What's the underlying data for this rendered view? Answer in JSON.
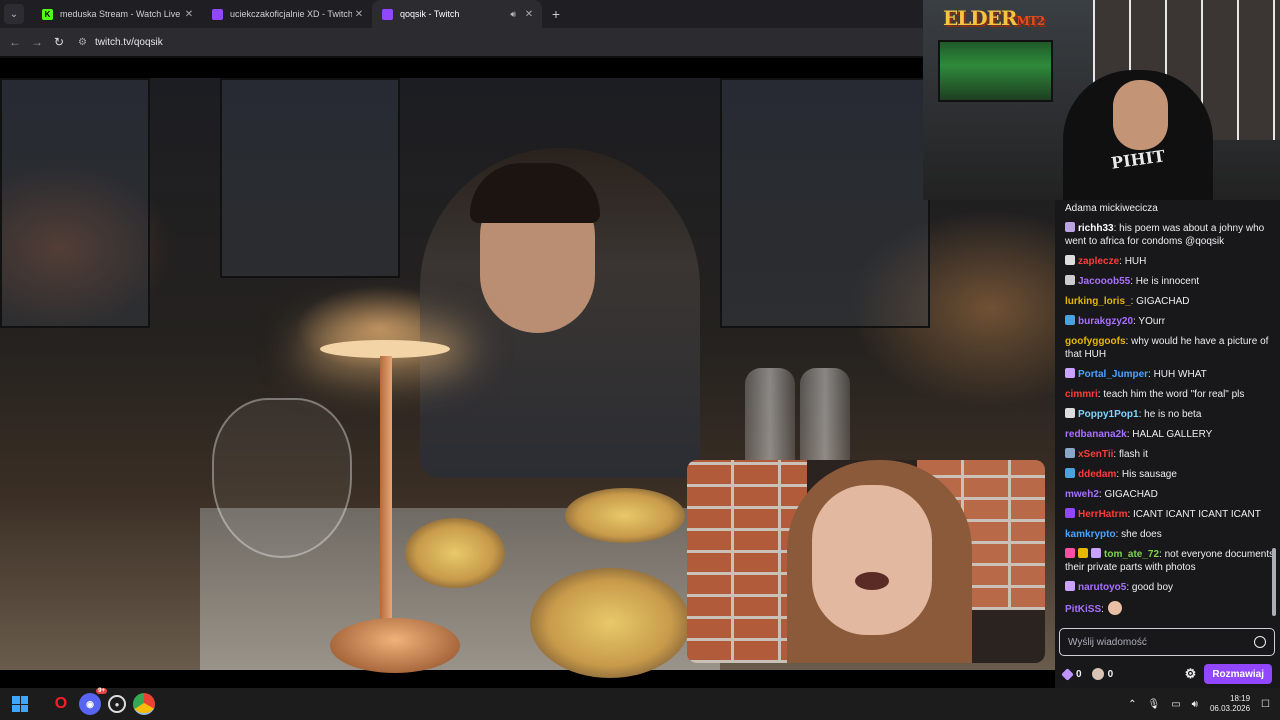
{
  "browser": {
    "tabs": [
      {
        "title": "meduska Stream - Watch Live o",
        "favicon": "kick",
        "active": false
      },
      {
        "title": "uciekczakoficjalnie XD - Twitch",
        "favicon": "twitch",
        "active": false
      },
      {
        "title": "qoqsik - Twitch",
        "favicon": "twitch",
        "active": true,
        "audio": true
      }
    ],
    "url": "twitch.tv/qoqsik"
  },
  "overlay": {
    "cam_logo_main": "ELDER",
    "cam_logo_suffix": "MT2",
    "shirt_text": "PIHIT"
  },
  "chat": {
    "messages": [
      {
        "user": "",
        "text": "Adama mickiwecicza",
        "color": "",
        "badges": []
      },
      {
        "user": "richh33",
        "text": ": his poem was about a johny who went to africa for condoms @qoqsik",
        "color": "#ffffff",
        "badges": [
          "#b9a3e3"
        ]
      },
      {
        "user": "zaplecze",
        "text": ": HUH",
        "color": "#ff3b3b",
        "badges": [
          "#dddddd"
        ]
      },
      {
        "user": "Jacooob55",
        "text": ": He is innocent",
        "color": "#a970ff",
        "badges": [
          "#cccccc"
        ]
      },
      {
        "user": "lurking_loris_",
        "text": ": GIGACHAD",
        "color": "#e6b800",
        "badges": []
      },
      {
        "user": "burakgzy20",
        "text": ": YOurr",
        "color": "#a970ff",
        "badges": [
          "#4aa3df"
        ]
      },
      {
        "user": "goofyggoofs",
        "text": ": why would he have a picture of that HUH",
        "color": "#e6b800",
        "badges": []
      },
      {
        "user": "Portal_Jumper",
        "text": ": HUH WHAT",
        "color": "#4aa3ff",
        "badges": [
          "#c9a3ff"
        ]
      },
      {
        "user": "cimmri",
        "text": ": teach him the word \"for real\" pls",
        "color": "#ff3b3b",
        "badges": []
      },
      {
        "user": "Poppy1Pop1",
        "text": ": he is no beta",
        "color": "#7fd6ff",
        "badges": [
          "#dddddd"
        ]
      },
      {
        "user": "redbanana2k",
        "text": ": HALAL GALLERY",
        "color": "#a970ff",
        "badges": []
      },
      {
        "user": "xSenTii",
        "text": ": flash it",
        "color": "#ff3b3b",
        "badges": [
          "#8aa7c9"
        ]
      },
      {
        "user": "ddedam",
        "text": ": His sausage",
        "color": "#ff3b3b",
        "badges": [
          "#4aa3df"
        ]
      },
      {
        "user": "mweh2",
        "text": ": GIGACHAD",
        "color": "#a970ff",
        "badges": []
      },
      {
        "user": "HerrHatrm",
        "text": ": ICANT ICANT ICANT ICANT",
        "color": "#ff3b3b",
        "badges": [
          "#9147ff"
        ]
      },
      {
        "user": "kamkrypto",
        "text": ": she does",
        "color": "#4aa3ff",
        "badges": []
      },
      {
        "user": "tom_ate_72",
        "text": ": not everyone documents their private parts with photos",
        "color": "#7cd44a",
        "badges": [
          "#ff4fa3",
          "#e6b800",
          "#c9a3ff"
        ]
      },
      {
        "user": "narutoyo5",
        "text": ": good boy",
        "color": "#a970ff",
        "badges": [
          "#c9a3ff"
        ]
      },
      {
        "user": "PitKiSS",
        "text": ":",
        "color": "#a970ff",
        "badges": [],
        "emote": true
      }
    ],
    "input_placeholder": "Wyślij wiadomość",
    "points_1": "0",
    "points_2": "0",
    "send_label": "Rozmawiaj"
  },
  "taskbar": {
    "time": "18:19",
    "date": "06.03.2026",
    "discord_badge": "9+"
  }
}
